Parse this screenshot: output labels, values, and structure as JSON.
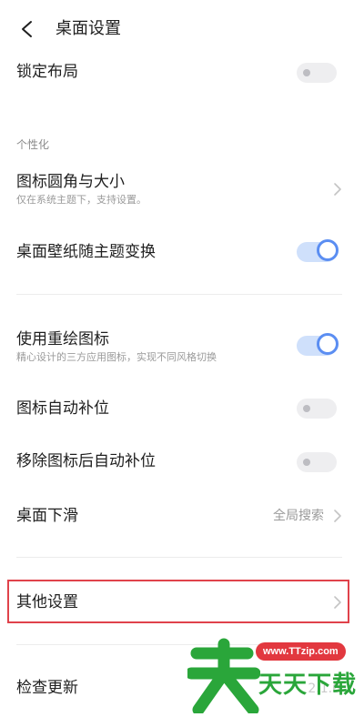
{
  "header": {
    "title": "桌面设置"
  },
  "rows": {
    "lock_layout": {
      "title": "锁定布局",
      "enabled": false
    },
    "section_personal": "个性化",
    "icon_corner": {
      "title": "图标圆角与大小",
      "subtitle": "仅在系统主题下，支持设置。"
    },
    "wallpaper_follow": {
      "title": "桌面壁纸随主题变换",
      "enabled": true
    },
    "redrawn_icons": {
      "title": "使用重绘图标",
      "subtitle": "精心设计的三方应用图标，实现不同风格切换",
      "enabled": true
    },
    "auto_fill": {
      "title": "图标自动补位",
      "enabled": false
    },
    "remove_auto_fill": {
      "title": "移除图标后自动补位",
      "enabled": false
    },
    "swipe_down": {
      "title": "桌面下滑",
      "value": "全局搜索"
    },
    "other_settings": {
      "title": "其他设置"
    },
    "check_update": {
      "title": "检查更新",
      "value": "2.1.0"
    }
  },
  "watermark": {
    "url": "www.TTzip.com",
    "text": "天天下载",
    "glyph": "天"
  },
  "colors": {
    "accent": "#5b8ef2",
    "highlight": "#e0424b",
    "watermark_green": "#2aa63a",
    "watermark_red": "#e2383f"
  }
}
